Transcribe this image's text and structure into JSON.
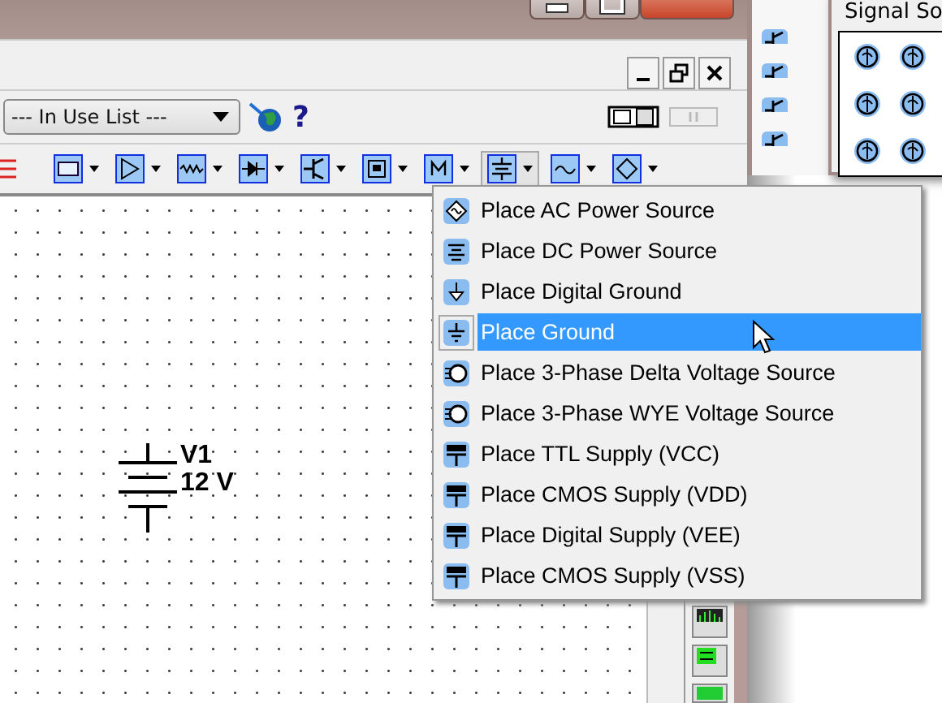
{
  "in_use_list": {
    "value": "--- In Use List ---"
  },
  "help": {
    "label": "?"
  },
  "toolbar": [
    {
      "kind": "digital",
      "expanded": false
    },
    {
      "kind": "opamp",
      "expanded": false
    },
    {
      "kind": "resistor",
      "expanded": false
    },
    {
      "kind": "diode",
      "expanded": false
    },
    {
      "kind": "transistor",
      "expanded": false
    },
    {
      "kind": "chip",
      "expanded": false
    },
    {
      "kind": "misc",
      "expanded": false
    },
    {
      "kind": "source",
      "expanded": true
    },
    {
      "kind": "signal",
      "expanded": false
    },
    {
      "kind": "indicator",
      "expanded": false
    }
  ],
  "side_panel": {
    "title": "Signal So"
  },
  "component": {
    "ref": "V1",
    "value": "12 V"
  },
  "menu": [
    {
      "label": "Place AC Power Source",
      "kind": "ac",
      "selected": false
    },
    {
      "label": "Place DC Power Source",
      "kind": "dc",
      "selected": false
    },
    {
      "label": "Place Digital Ground",
      "kind": "dground",
      "selected": false
    },
    {
      "label": "Place Ground",
      "kind": "ground",
      "selected": true
    },
    {
      "label": "Place 3-Phase Delta Voltage Source",
      "kind": "delta",
      "selected": false
    },
    {
      "label": "Place 3-Phase WYE Voltage Source",
      "kind": "wye",
      "selected": false
    },
    {
      "label": "Place TTL Supply (VCC)",
      "kind": "supply",
      "selected": false
    },
    {
      "label": "Place CMOS Supply (VDD)",
      "kind": "supply",
      "selected": false
    },
    {
      "label": "Place Digital Supply (VEE)",
      "kind": "supply",
      "selected": false
    },
    {
      "label": "Place CMOS Supply (VSS)",
      "kind": "supply",
      "selected": false
    }
  ]
}
